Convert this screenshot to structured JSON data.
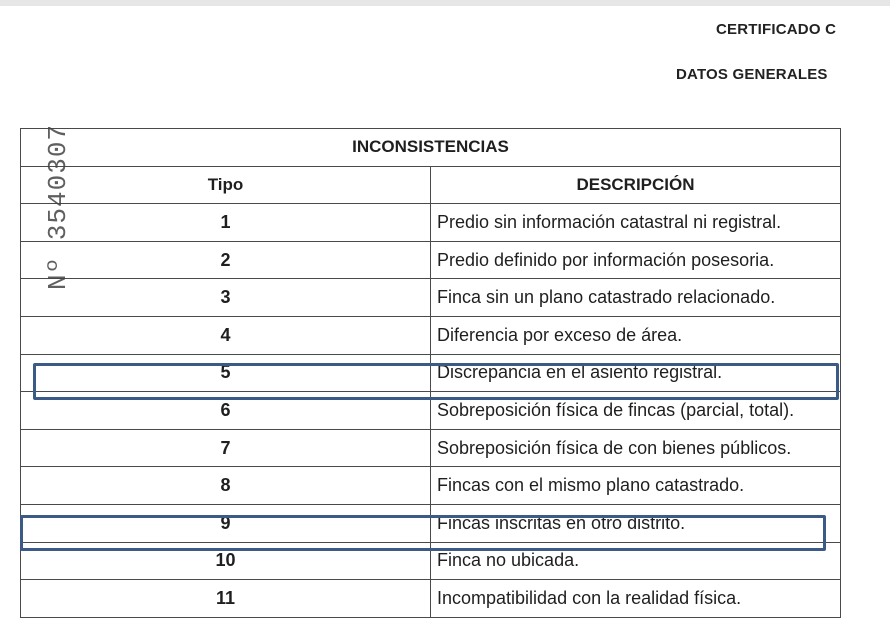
{
  "header": {
    "line1": "CERTIFICADO C",
    "line2": "DATOS GENERALES"
  },
  "serial_stamp": "Nº 3540307",
  "table": {
    "title": "INCONSISTENCIAS",
    "columns": [
      "Tipo",
      "DESCRIPCIÓN"
    ],
    "rows": [
      {
        "tipo": "1",
        "descripcion": "Predio sin información catastral ni registral."
      },
      {
        "tipo": "2",
        "descripcion": "Predio definido por información posesoria."
      },
      {
        "tipo": "3",
        "descripcion": "Finca sin un plano catastrado relacionado."
      },
      {
        "tipo": "4",
        "descripcion": "Diferencia por exceso de área."
      },
      {
        "tipo": "5",
        "descripcion": "Discrepancia en el asiento registral."
      },
      {
        "tipo": "6",
        "descripcion": "Sobreposición física de fincas (parcial, total)."
      },
      {
        "tipo": "7",
        "descripcion": "Sobreposición física de con bienes públicos."
      },
      {
        "tipo": "8",
        "descripcion": "Fincas con el mismo plano catastrado."
      },
      {
        "tipo": "9",
        "descripcion": "Fincas inscritas en otro distrito."
      },
      {
        "tipo": "10",
        "descripcion": "Finca no ubicada."
      },
      {
        "tipo": "11",
        "descripcion": "Incompatibilidad con la realidad física."
      }
    ]
  },
  "highlights": {
    "color": "#3c5a86",
    "rows": [
      "5",
      "9"
    ]
  }
}
